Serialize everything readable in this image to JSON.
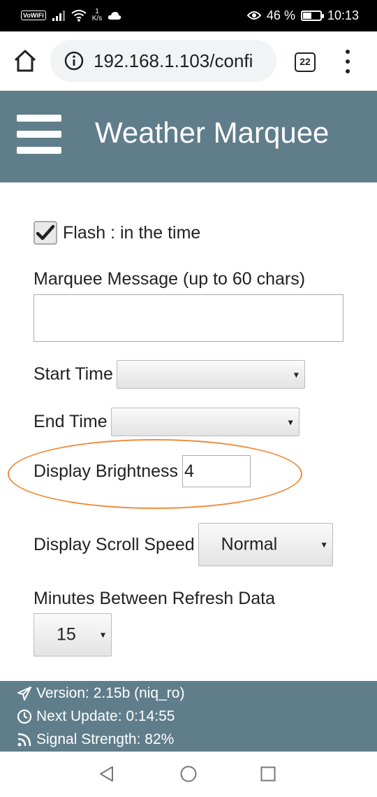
{
  "status_bar": {
    "vowifi": "VoWiFi",
    "net_speed_value": "1",
    "net_speed_unit": "K/s",
    "battery_percent": "46 %",
    "battery_level": 0.46,
    "time": "10:13"
  },
  "browser": {
    "url": "192.168.1.103/confi",
    "tab_count": "22"
  },
  "header": {
    "title": "Weather Marquee"
  },
  "form": {
    "flash_label": "Flash : in the time",
    "flash_checked": true,
    "marquee_label": "Marquee Message (up to 60 chars)",
    "marquee_value": "",
    "start_time_label": "Start Time",
    "start_time_value": "",
    "end_time_label": "End Time",
    "end_time_value": "",
    "brightness_label": "Display Brightness",
    "brightness_value": "4",
    "scroll_speed_label": "Display Scroll Speed",
    "scroll_speed_value": "Normal",
    "refresh_label": "Minutes Between Refresh Data",
    "refresh_value": "15"
  },
  "footer": {
    "version": "Version: 2.15b (niq_ro)",
    "next_update": "Next Update: 0:14:55",
    "signal": "Signal Strength: 82%"
  },
  "icons": {
    "select_arrow": "▾",
    "accent_color": "#607d8b",
    "highlight_color": "#f08a3a"
  }
}
